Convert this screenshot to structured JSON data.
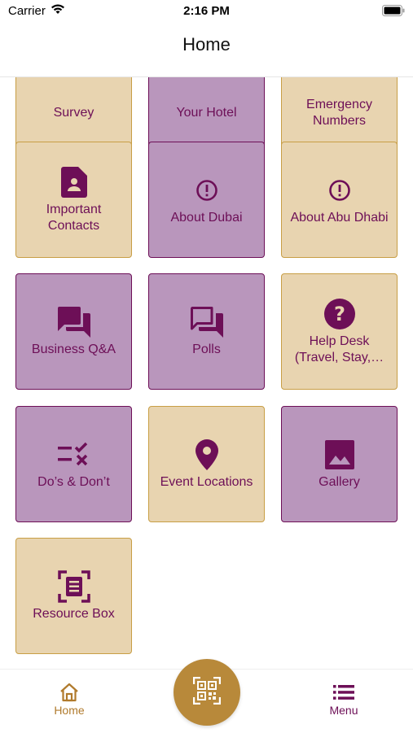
{
  "status_bar": {
    "carrier": "Carrier",
    "time": "2:16 PM"
  },
  "header": {
    "title": "Home"
  },
  "tiles": [
    {
      "label": "Survey"
    },
    {
      "label": "Your Hotel"
    },
    {
      "label": "Emergency Numbers"
    },
    {
      "label": "Important Contacts",
      "icon": "contact-card-icon"
    },
    {
      "label": "About Dubai",
      "icon": "info-circle-icon"
    },
    {
      "label": "About Abu Dhabi",
      "icon": "info-circle-icon"
    },
    {
      "label": "Business Q&A",
      "icon": "chat-bubbles-icon"
    },
    {
      "label": "Polls",
      "icon": "chat-bubbles-outline-icon"
    },
    {
      "label": "Help Desk (Travel, Stay,…",
      "icon": "question-circle-icon"
    },
    {
      "label": "Do’s & Don’t",
      "icon": "checklist-icon"
    },
    {
      "label": "Event Locations",
      "icon": "location-pin-icon"
    },
    {
      "label": "Gallery",
      "icon": "image-icon"
    },
    {
      "label": "Resource Box",
      "icon": "document-scan-icon"
    }
  ],
  "tab_bar": {
    "home_label": "Home",
    "menu_label": "Menu",
    "scan_icon": "qr-scan-icon"
  },
  "colors": {
    "beige_tile": "#e8d4b0",
    "purple_tile": "#b996bc",
    "accent_gold": "#b8893a",
    "text_purple": "#6d0f57"
  }
}
